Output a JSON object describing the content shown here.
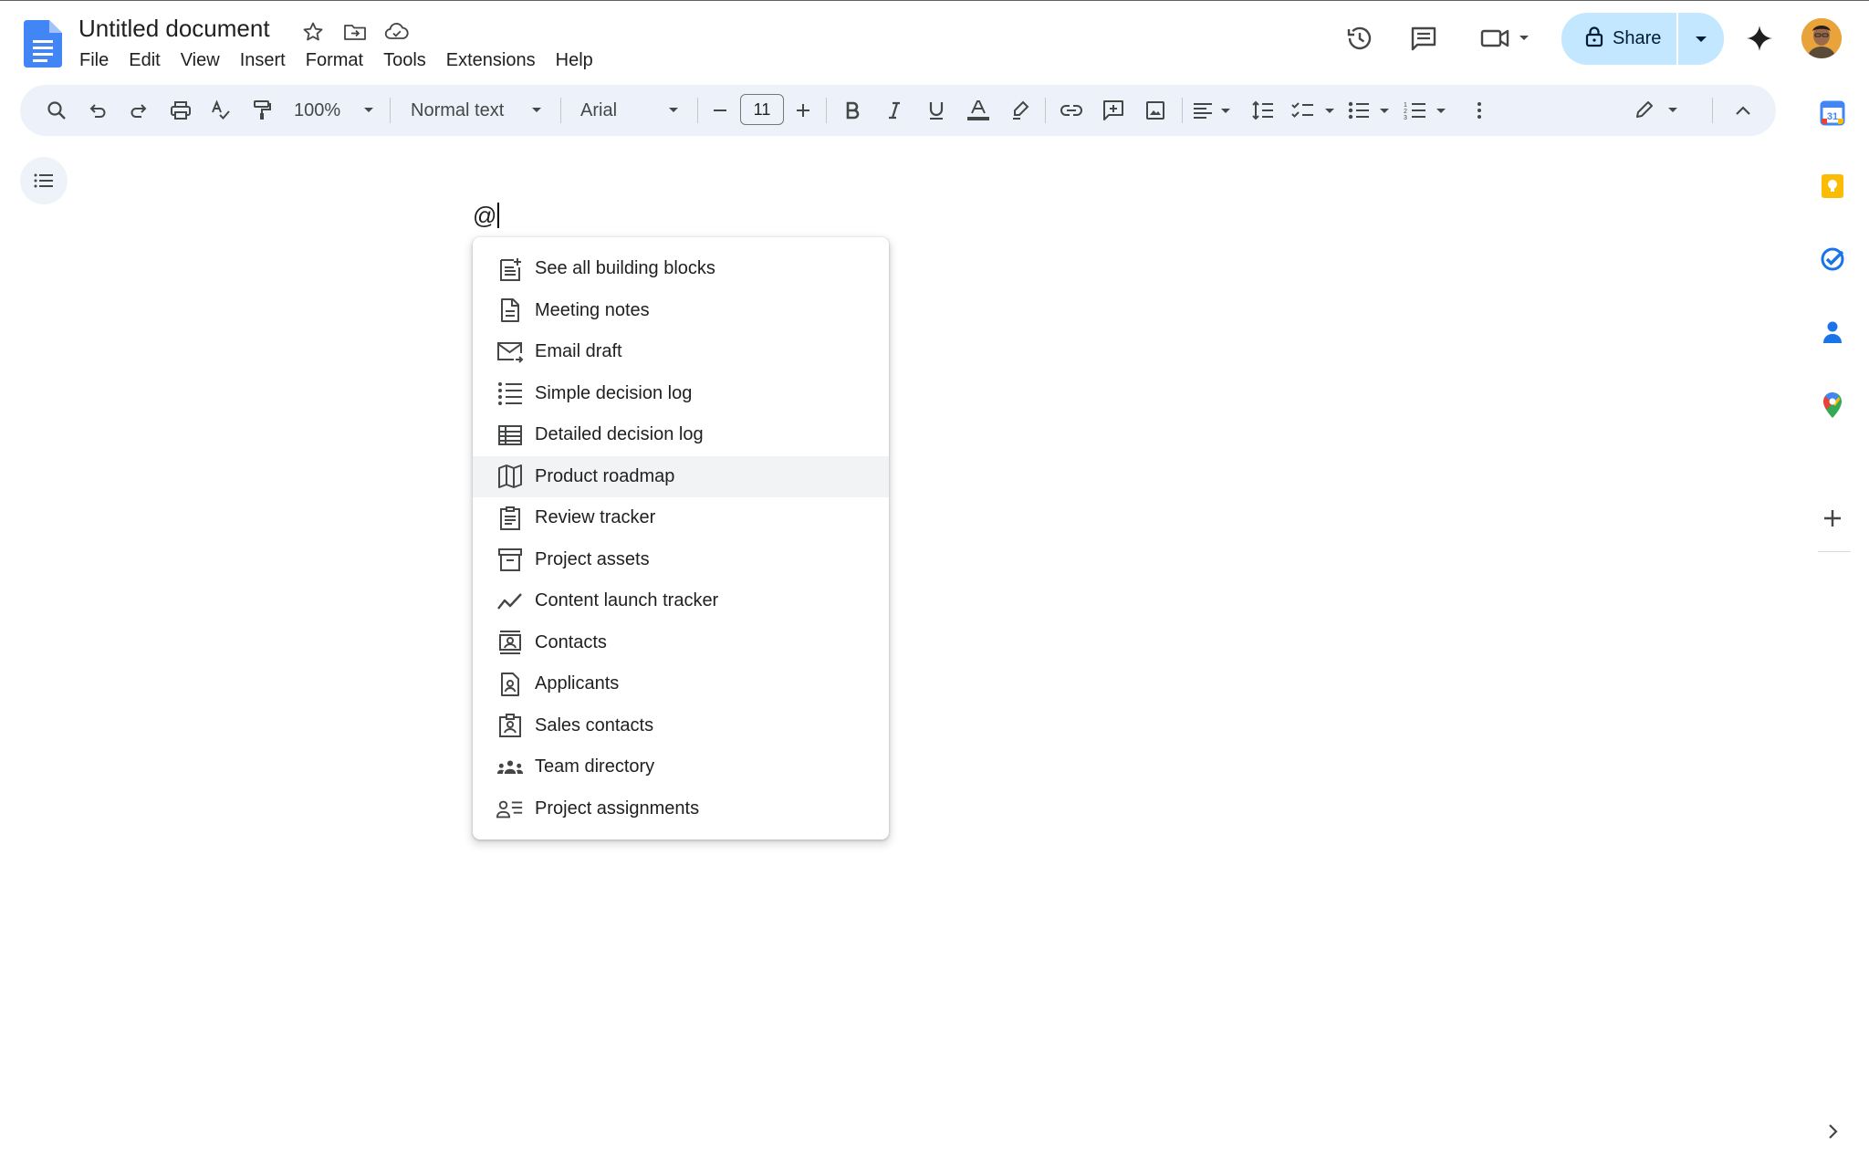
{
  "document": {
    "title": "Untitled document",
    "body_text": "@"
  },
  "menu": {
    "items": [
      "File",
      "Edit",
      "View",
      "Insert",
      "Format",
      "Tools",
      "Extensions",
      "Help"
    ]
  },
  "header": {
    "share_label": "Share"
  },
  "toolbar": {
    "zoom": "100%",
    "style": "Normal text",
    "font": "Arial",
    "font_size": "11"
  },
  "building_blocks": {
    "highlighted_index": 5,
    "items": [
      {
        "label": "See all building blocks",
        "icon": "add-note-icon"
      },
      {
        "label": "Meeting notes",
        "icon": "document-icon"
      },
      {
        "label": "Email draft",
        "icon": "email-send-icon"
      },
      {
        "label": "Simple decision log",
        "icon": "list-icon"
      },
      {
        "label": "Detailed decision log",
        "icon": "table-icon"
      },
      {
        "label": "Product roadmap",
        "icon": "map-icon"
      },
      {
        "label": "Review tracker",
        "icon": "clipboard-icon"
      },
      {
        "label": "Project assets",
        "icon": "archive-icon"
      },
      {
        "label": "Content launch tracker",
        "icon": "trend-icon"
      },
      {
        "label": "Contacts",
        "icon": "contact-card-icon"
      },
      {
        "label": "Applicants",
        "icon": "applicant-icon"
      },
      {
        "label": "Sales contacts",
        "icon": "contact-badge-icon"
      },
      {
        "label": "Team directory",
        "icon": "groups-icon"
      },
      {
        "label": "Project assignments",
        "icon": "person-list-icon"
      }
    ]
  },
  "colors": {
    "docs_blue": "#4285f4",
    "share_bg": "#c2e7ff",
    "toolbar_bg": "#edf2fa",
    "highlight": "#f1f3f4"
  }
}
